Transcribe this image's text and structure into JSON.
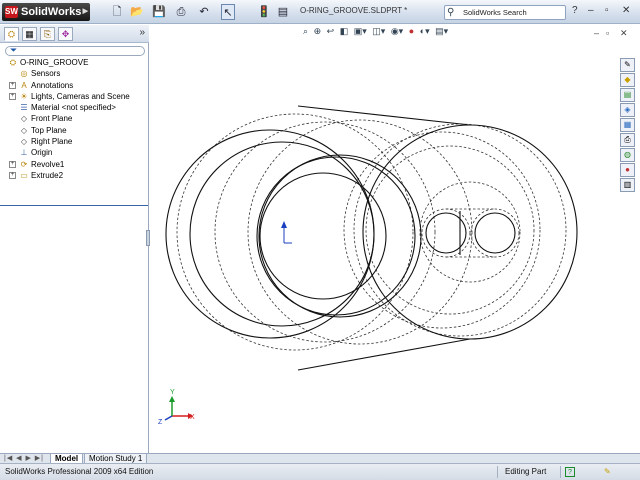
{
  "app": {
    "logo_text": "SolidWorks",
    "window_title": "O-RING_GROOVE.SLDPRT *"
  },
  "toolbar": {
    "icons": [
      "new-icon",
      "open-icon",
      "save-icon",
      "print-icon",
      "undo-icon",
      "select-icon",
      "rebuild-icon",
      "options-icon"
    ]
  },
  "search": {
    "placeholder": "SolidWorks Search"
  },
  "feature_manager": {
    "tabs": [
      "featuremanager-tab",
      "propertymanager-tab",
      "configurationmanager-tab",
      "dimxpert-tab"
    ],
    "root": "O-RING_GROOVE",
    "items": [
      {
        "label": "Sensors",
        "icon": "sensors-icon",
        "expandable": false
      },
      {
        "label": "Annotations",
        "icon": "annotations-icon",
        "expandable": true
      },
      {
        "label": "Lights, Cameras and Scene",
        "icon": "lights-icon",
        "expandable": true
      },
      {
        "label": "Material <not specified>",
        "icon": "material-icon",
        "expandable": false
      },
      {
        "label": "Front Plane",
        "icon": "plane-icon",
        "expandable": false
      },
      {
        "label": "Top Plane",
        "icon": "plane-icon",
        "expandable": false
      },
      {
        "label": "Right Plane",
        "icon": "plane-icon",
        "expandable": false
      },
      {
        "label": "Origin",
        "icon": "origin-icon",
        "expandable": false
      },
      {
        "label": "Revolve1",
        "icon": "revolve-icon",
        "expandable": true
      },
      {
        "label": "Extrude2",
        "icon": "extrude-icon",
        "expandable": true
      }
    ]
  },
  "bottom_tabs": [
    "Model",
    "Motion Study 1"
  ],
  "status_bar": {
    "edition": "SolidWorks Professional 2009 x64 Edition",
    "mode": "Editing Part"
  },
  "triad": {
    "x": "X",
    "y": "Y",
    "z": "Z"
  },
  "colors": {
    "accent": "#3a62a7",
    "logo_red": "#c4161c",
    "axis_x": "#d21e1e",
    "axis_y": "#1a9a2a",
    "axis_z": "#1c3fbf"
  }
}
